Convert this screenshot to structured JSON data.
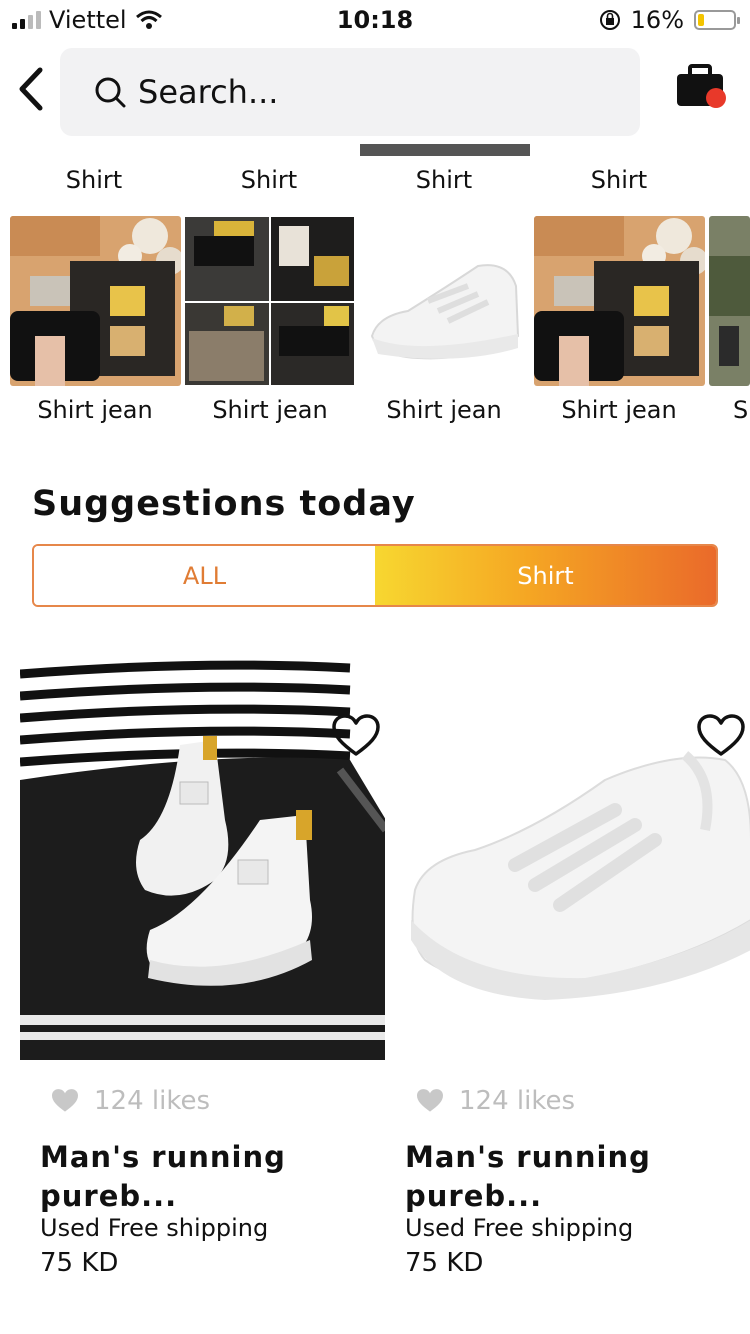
{
  "status_bar": {
    "carrier": "Viettel",
    "time": "10:18",
    "battery": "16%"
  },
  "header": {
    "search_placeholder": "Search..."
  },
  "category_labels": [
    "Shirt",
    "Shirt",
    "Shirt",
    "Shirt"
  ],
  "category_captions": [
    "Shirt jean",
    "Shirt jean",
    "Shirt jean",
    "Shirt jean",
    "S"
  ],
  "suggestions": {
    "title": "Suggestions today",
    "tabs": [
      "ALL",
      "Shirt"
    ],
    "active_tab": "Shirt"
  },
  "products": [
    {
      "likes": "124 likes",
      "name_line1": "Man's running",
      "name_line2": "pureb...",
      "shipping": "Used Free shipping",
      "price": "75 KD"
    },
    {
      "likes": "124 likes",
      "name_line1": "Man's running",
      "name_line2": "pureb...",
      "shipping": "Used Free shipping",
      "price": "75 KD"
    }
  ],
  "colors": {
    "accent_orange": "#e6874a",
    "gradient_start": "#f7d730",
    "gradient_end": "#ea6a2a",
    "cart_badge": "#e8392a"
  }
}
